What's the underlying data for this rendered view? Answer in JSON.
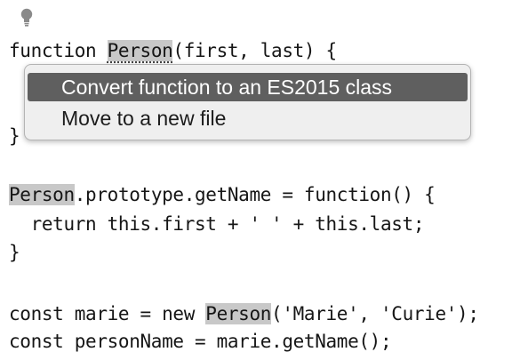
{
  "editor": {
    "highlight_color": "#c8c8c8",
    "lightbulb_icon": "lightbulb-icon",
    "lines": {
      "l1": {
        "a": "function ",
        "b": "Person",
        "c": "(first, last) {"
      },
      "l2": {
        "a": "}"
      },
      "l4": {
        "a": "Person",
        "b": ".prototype.getName = function() {"
      },
      "l5": {
        "a": "  return this.first + ' ' + this.last;"
      },
      "l6": {
        "a": "}"
      },
      "l8": {
        "a": "const marie = new ",
        "b": "Person",
        "c": "('Marie', 'Curie');"
      },
      "l9": {
        "a": "const personName = marie.getName();"
      }
    }
  },
  "context_menu": {
    "selected_color": "#5f5f5f",
    "items": [
      {
        "label": "Convert function to an ES2015 class",
        "selected": true
      },
      {
        "label": "Move to a new file",
        "selected": false
      }
    ]
  }
}
